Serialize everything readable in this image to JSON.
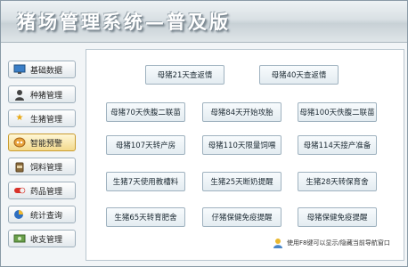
{
  "app": {
    "title": "猪场管理系统—普及版"
  },
  "sidebar": {
    "items": [
      {
        "label": "基础数据",
        "icon": "monitor-icon",
        "active": false
      },
      {
        "label": "种猪管理",
        "icon": "person-icon",
        "active": false
      },
      {
        "label": "生猪管理",
        "icon": "star-icon",
        "active": false
      },
      {
        "label": "智能预警",
        "icon": "alarm-icon",
        "active": true
      },
      {
        "label": "饲料管理",
        "icon": "feed-bag-icon",
        "active": false
      },
      {
        "label": "药品管理",
        "icon": "pill-icon",
        "active": false
      },
      {
        "label": "统计查询",
        "icon": "chart-icon",
        "active": false
      },
      {
        "label": "收支管理",
        "icon": "money-icon",
        "active": false
      }
    ]
  },
  "main": {
    "buttons": [
      {
        "label": "母猪21天查返情"
      },
      {
        "label": "母猪40天查返情"
      },
      {
        "label": "母猪70天佚腹二联苗"
      },
      {
        "label": "母猪84天开始攻胎"
      },
      {
        "label": "母猪100天佚腹二联苗"
      },
      {
        "label": "母猪107天转产房"
      },
      {
        "label": "母猪110天限量饲喂"
      },
      {
        "label": "母猪114天接产准备"
      },
      {
        "label": "生猪7天使用教槽料"
      },
      {
        "label": "生猪25天断奶提醒"
      },
      {
        "label": "生猪28天转保育舍"
      },
      {
        "label": "生猪65天转育肥舍"
      },
      {
        "label": "仔猪保健免疫提醒"
      },
      {
        "label": "母猪保健免疫提醒"
      }
    ]
  },
  "footer": {
    "hint": "使用F8键可以显示/隐藏当前导航窗口"
  },
  "colors": {
    "accent": "#f3d98c",
    "button_border": "#9fb2bf"
  }
}
